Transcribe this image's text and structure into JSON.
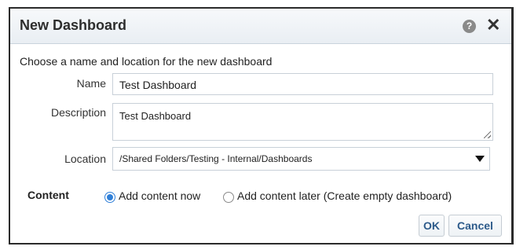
{
  "dialog": {
    "title": "New Dashboard",
    "help_icon": "question-circle-icon",
    "help_glyph": "?",
    "close_icon": "close-icon",
    "close_glyph": "✕"
  },
  "form": {
    "instructions": "Choose a name and location for the new dashboard",
    "name_label": "Name",
    "name_value": "Test Dashboard",
    "description_label": "Description",
    "description_value": "Test Dashboard",
    "location_label": "Location",
    "location_value": "/Shared Folders/Testing - Internal/Dashboards",
    "content_label": "Content",
    "content_options": [
      {
        "label": "Add content now",
        "selected": true
      },
      {
        "label": "Add content later (Create empty dashboard)",
        "selected": false
      }
    ]
  },
  "buttons": {
    "ok_label": "OK",
    "cancel_label": "Cancel"
  },
  "colors": {
    "accent": "#2f7fd8",
    "button_text": "#2c5a8a"
  }
}
